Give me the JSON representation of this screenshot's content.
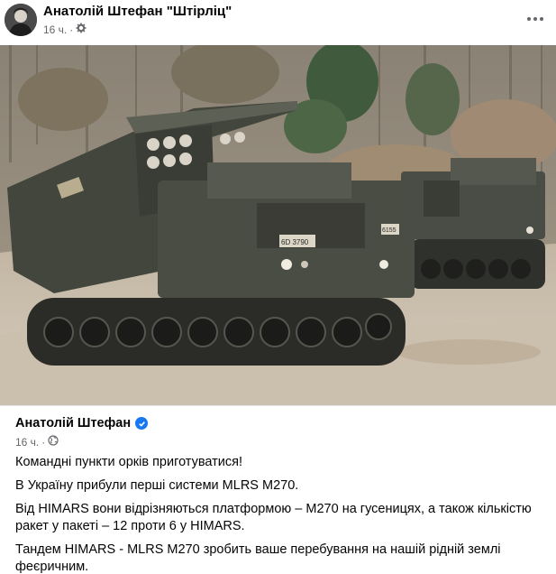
{
  "header": {
    "author": "Анатолій Штефан \"Штірліц\"",
    "time": "16 ч.",
    "privacy_icon": "gear-icon",
    "more_icon": "more-horizontal-icon"
  },
  "photo": {
    "vehicle_marking": "6D 3790",
    "vehicle_number": "6155"
  },
  "shared_post": {
    "author": "Анатолій Штефан",
    "verified_icon": "verified-badge-icon",
    "time": "16 ч.",
    "privacy_icon": "globe-icon",
    "paragraphs": [
      "Командні пункти орків приготуватися!",
      "В Україну прибули перші системи MLRS M270.",
      "Від HIMARS вони відрізняються платформою – M270 на гусеницях, а також кількістю ракет у пакеті – 12 проти 6 у HIMARS.",
      "Тандем HIMARS - MLRS M270 зробить ваше перебування на нашій рідній землі феєричним."
    ]
  },
  "colors": {
    "accent": "#1877f2",
    "meta_text": "#65676b",
    "text": "#050505"
  }
}
